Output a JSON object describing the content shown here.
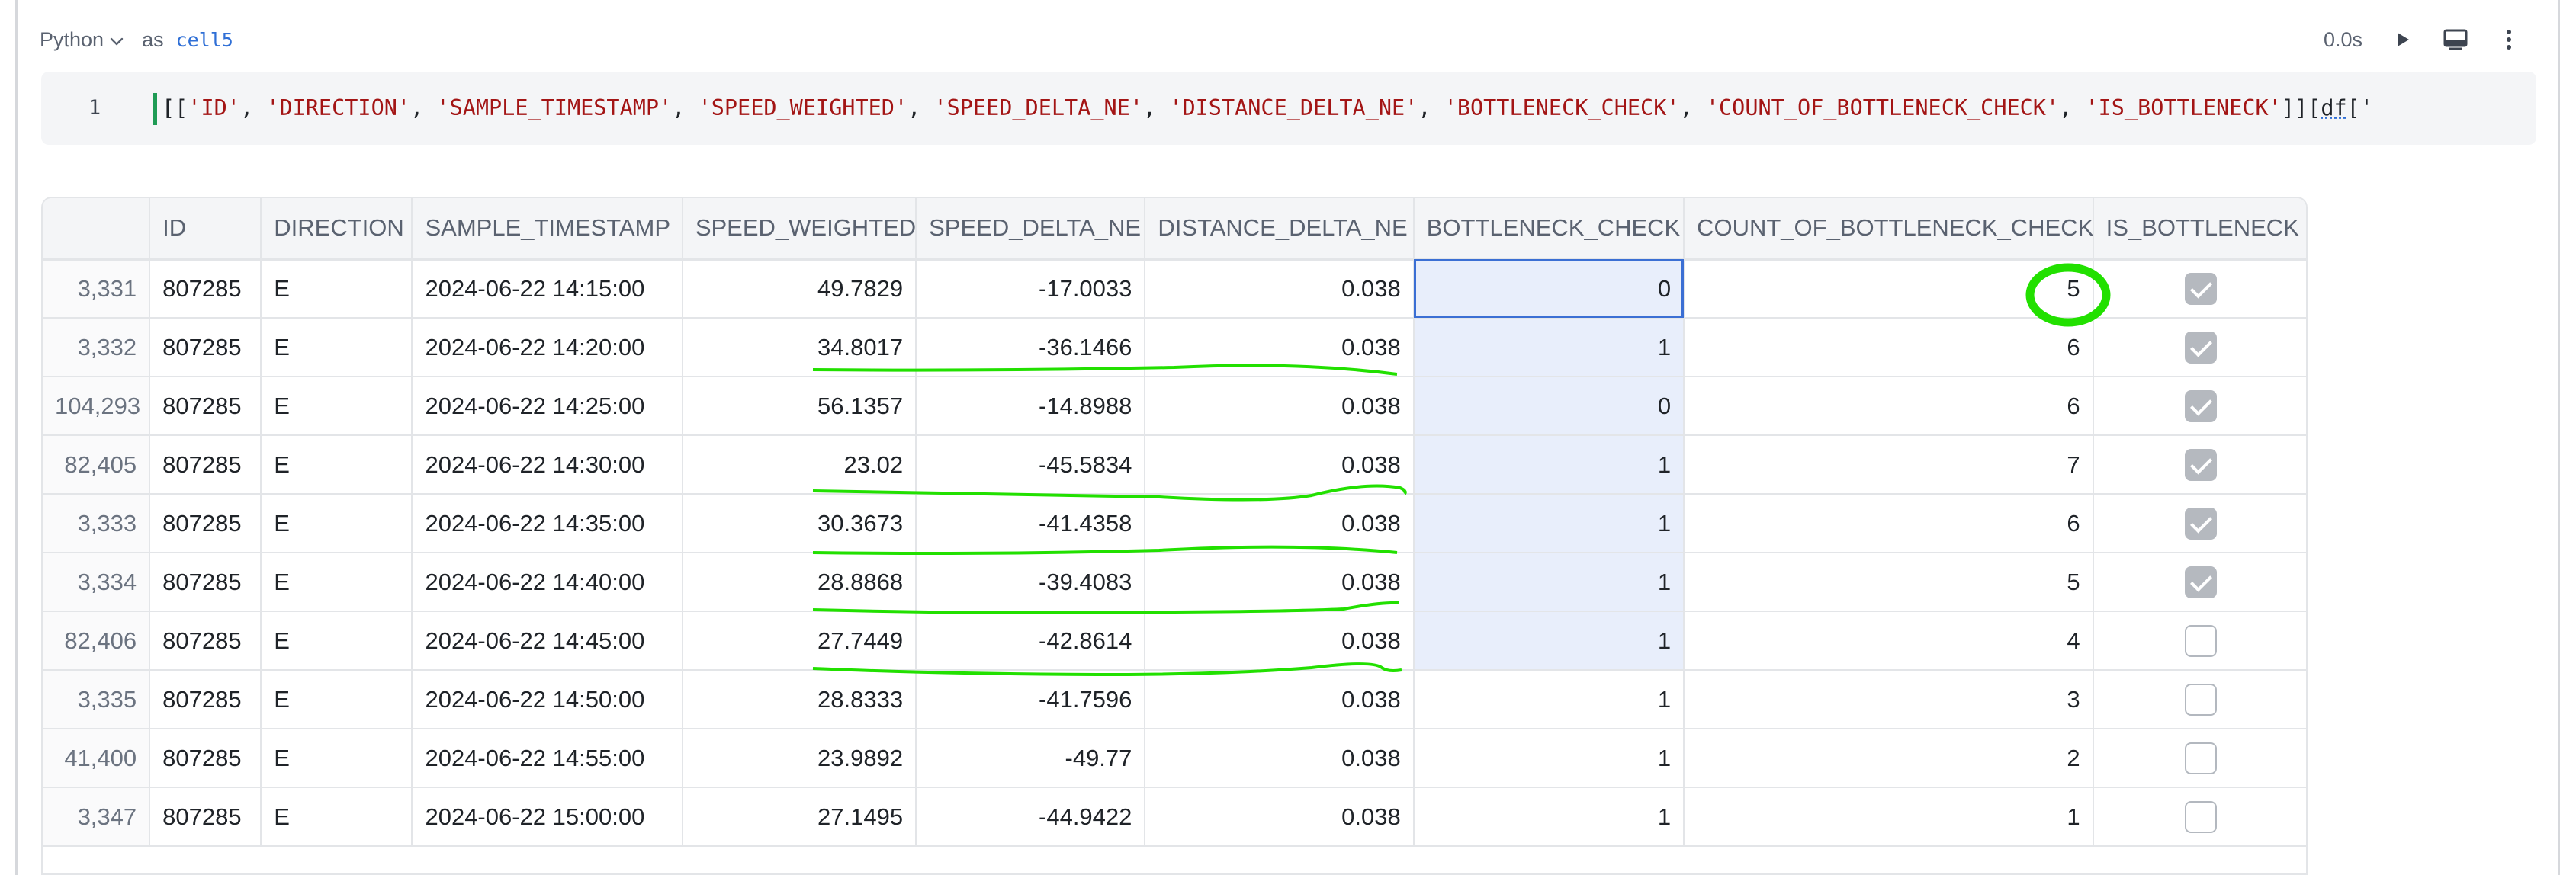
{
  "cell": {
    "language": "Python",
    "as_label": "as",
    "name": "cell5",
    "exec_time": "0.0s"
  },
  "editor": {
    "line_number": "1",
    "code_open": "[[",
    "columns": [
      "'ID'",
      "'DIRECTION'",
      "'SAMPLE_TIMESTAMP'",
      "'SPEED_WEIGHTED'",
      "'SPEED_DELTA_NE'",
      "'DISTANCE_DELTA_NE'",
      "'BOTTLENECK_CHECK'",
      "'COUNT_OF_BOTTLENECK_CHECK'",
      "'IS_BOTTLENECK'"
    ],
    "code_close": "]][",
    "code_var": "df",
    "code_tail": "['"
  },
  "table": {
    "headers": [
      "",
      "ID",
      "DIRECTION",
      "SAMPLE_TIMESTAMP",
      "SPEED_WEIGHTED",
      "SPEED_DELTA_NE",
      "DISTANCE_DELTA_NE",
      "BOTTLENECK_CHECK",
      "COUNT_OF_BOTTLENECK_CHECK",
      "IS_BOTTLENECK"
    ],
    "rows": [
      {
        "index": "3,331",
        "id": "807285",
        "direction": "E",
        "timestamp": "2024-06-22 14:15:00",
        "speed_weighted": "49.7829",
        "speed_delta": "-17.0033",
        "distance_delta": "0.038",
        "bottleneck_check": "0",
        "count": "5",
        "is_bottleneck": true
      },
      {
        "index": "3,332",
        "id": "807285",
        "direction": "E",
        "timestamp": "2024-06-22 14:20:00",
        "speed_weighted": "34.8017",
        "speed_delta": "-36.1466",
        "distance_delta": "0.038",
        "bottleneck_check": "1",
        "count": "6",
        "is_bottleneck": true
      },
      {
        "index": "104,293",
        "id": "807285",
        "direction": "E",
        "timestamp": "2024-06-22 14:25:00",
        "speed_weighted": "56.1357",
        "speed_delta": "-14.8988",
        "distance_delta": "0.038",
        "bottleneck_check": "0",
        "count": "6",
        "is_bottleneck": true
      },
      {
        "index": "82,405",
        "id": "807285",
        "direction": "E",
        "timestamp": "2024-06-22 14:30:00",
        "speed_weighted": "23.02",
        "speed_delta": "-45.5834",
        "distance_delta": "0.038",
        "bottleneck_check": "1",
        "count": "7",
        "is_bottleneck": true
      },
      {
        "index": "3,333",
        "id": "807285",
        "direction": "E",
        "timestamp": "2024-06-22 14:35:00",
        "speed_weighted": "30.3673",
        "speed_delta": "-41.4358",
        "distance_delta": "0.038",
        "bottleneck_check": "1",
        "count": "6",
        "is_bottleneck": true
      },
      {
        "index": "3,334",
        "id": "807285",
        "direction": "E",
        "timestamp": "2024-06-22 14:40:00",
        "speed_weighted": "28.8868",
        "speed_delta": "-39.4083",
        "distance_delta": "0.038",
        "bottleneck_check": "1",
        "count": "5",
        "is_bottleneck": true
      },
      {
        "index": "82,406",
        "id": "807285",
        "direction": "E",
        "timestamp": "2024-06-22 14:45:00",
        "speed_weighted": "27.7449",
        "speed_delta": "-42.8614",
        "distance_delta": "0.038",
        "bottleneck_check": "1",
        "count": "4",
        "is_bottleneck": false
      },
      {
        "index": "3,335",
        "id": "807285",
        "direction": "E",
        "timestamp": "2024-06-22 14:50:00",
        "speed_weighted": "28.8333",
        "speed_delta": "-41.7596",
        "distance_delta": "0.038",
        "bottleneck_check": "1",
        "count": "3",
        "is_bottleneck": false
      },
      {
        "index": "41,400",
        "id": "807285",
        "direction": "E",
        "timestamp": "2024-06-22 14:55:00",
        "speed_weighted": "23.9892",
        "speed_delta": "-49.77",
        "distance_delta": "0.038",
        "bottleneck_check": "1",
        "count": "2",
        "is_bottleneck": false
      },
      {
        "index": "3,347",
        "id": "807285",
        "direction": "E",
        "timestamp": "2024-06-22 15:00:00",
        "speed_weighted": "27.1495",
        "speed_delta": "-44.9422",
        "distance_delta": "0.038",
        "bottleneck_check": "1",
        "count": "1",
        "is_bottleneck": false
      }
    ]
  },
  "colors": {
    "accent": "#2f6fd6",
    "annotation": "#22e000",
    "string": "#a31515",
    "highlight": "#e8eefb"
  },
  "icons": {
    "lang_dropdown": "chevron-down-icon",
    "run": "play-icon",
    "output_toggle": "screen-icon",
    "more": "kebab-menu-icon"
  }
}
